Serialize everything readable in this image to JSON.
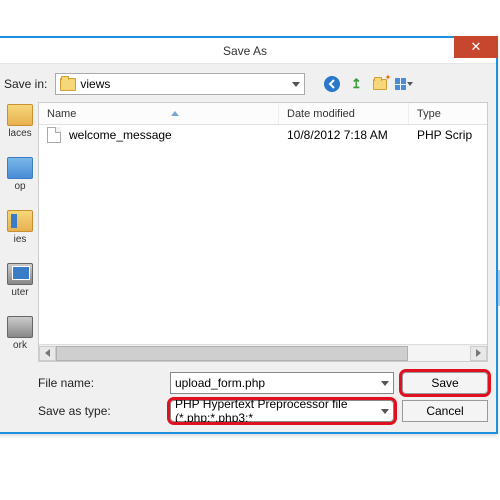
{
  "dialog": {
    "title": "Save As",
    "save_in_label": "Save in:",
    "folder_name": "views",
    "columns": {
      "name": "Name",
      "date": "Date modified",
      "type": "Type"
    },
    "files": [
      {
        "name": "welcome_message",
        "date": "10/8/2012 7:18 AM",
        "type": "PHP Scrip"
      }
    ],
    "file_name_label": "File name:",
    "file_name_value": "upload_form.php",
    "save_as_type_label": "Save as type:",
    "save_as_type_value": "PHP Hypertext Preprocessor file (*.php;*.php3;*",
    "save_btn": "Save",
    "cancel_btn": "Cancel",
    "sidebar": [
      {
        "label": "laces"
      },
      {
        "label": "op"
      },
      {
        "label": "ies"
      },
      {
        "label": "uter"
      },
      {
        "label": "ork"
      }
    ]
  }
}
